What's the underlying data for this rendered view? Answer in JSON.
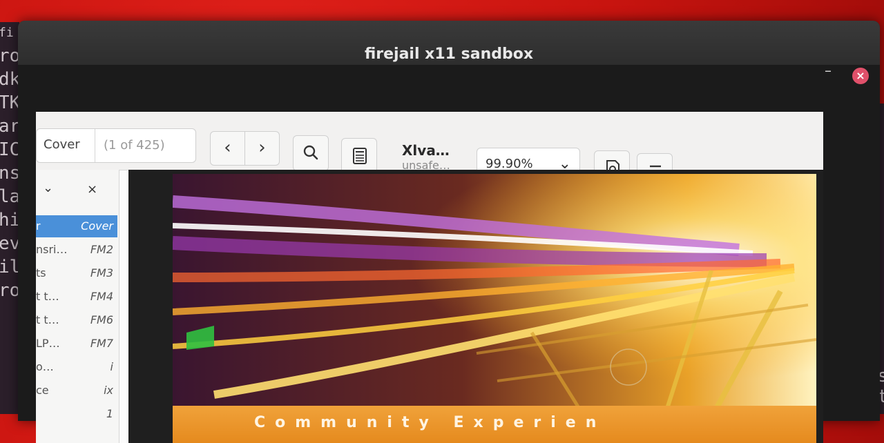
{
  "background": {
    "left_terminal_lines": [
      "fi",
      "ro",
      "dk",
      "TK",
      "ar",
      "IC",
      "ns",
      "la",
      "hi",
      "",
      "ev",
      "il",
      "ro"
    ],
    "right_terminal_lines": [
      "es",
      "st"
    ]
  },
  "window": {
    "title": "firejail x11 sandbox",
    "minimize": "–",
    "close": "×"
  },
  "toolbar": {
    "page_label": "Cover",
    "page_count": "(1 of 425)",
    "prev": "‹",
    "next": "›",
    "search_icon": "search-icon",
    "notes_icon": "notes-icon",
    "doc_title": "Xlva…",
    "doc_subtitle": "unsafe…",
    "zoom_value": "99.90%",
    "zoom_chevron": "⌄",
    "annotate_icon": "annotate-icon",
    "menu_icon": "menu-icon",
    "win_min": "–",
    "win_max": "□",
    "win_close": "×"
  },
  "sidebar": {
    "collapse": "⌄",
    "close": "×",
    "items": [
      {
        "title": "r",
        "page": "Cover"
      },
      {
        "title": "nsri…",
        "page": "FM2"
      },
      {
        "title": "ts",
        "page": "FM3"
      },
      {
        "title": "t t…",
        "page": "FM4"
      },
      {
        "title": "t t…",
        "page": "FM6"
      },
      {
        "title": "LP…",
        "page": "FM7"
      },
      {
        "title": "o…",
        "page": "i"
      },
      {
        "title": "ce",
        "page": "ix"
      },
      {
        "title": "",
        "page": "1"
      }
    ]
  },
  "cover": {
    "banner_text": "Community Experien"
  },
  "colors": {
    "accent": "#4a90d9",
    "close_button": "#e0506a",
    "banner": "#e8901f"
  }
}
